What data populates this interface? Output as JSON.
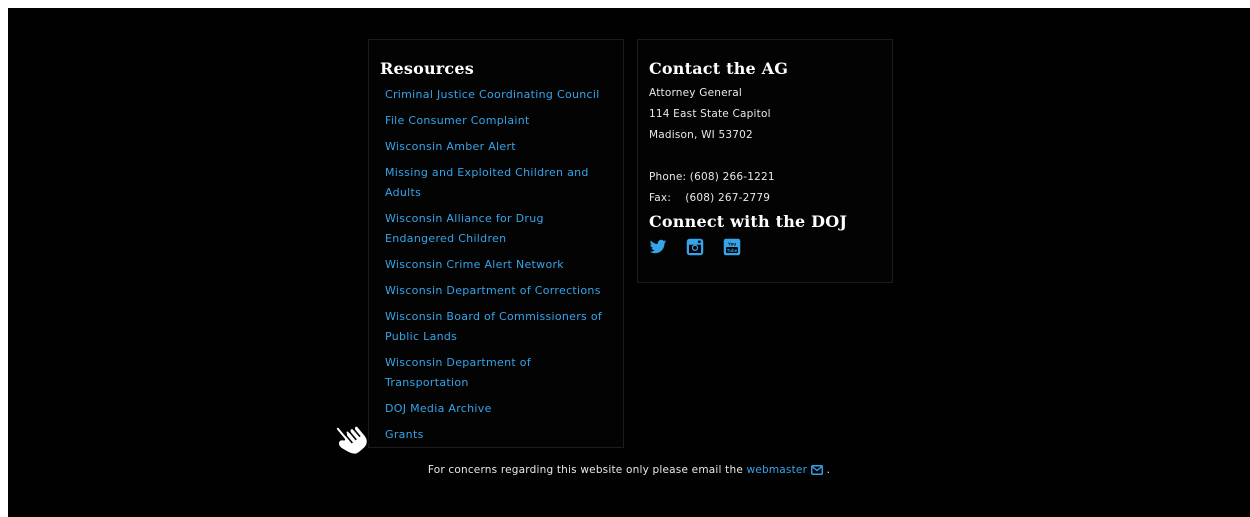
{
  "resources": {
    "title": "Resources",
    "links": [
      "Criminal Justice Coordinating Council",
      "File Consumer Complaint",
      "Wisconsin Amber Alert",
      "Missing and Exploited Children and Adults",
      "Wisconsin Alliance for Drug Endangered Children",
      "Wisconsin Crime Alert Network",
      "Wisconsin Department of Corrections",
      "Wisconsin Board of Commissioners of Public Lands",
      "Wisconsin Department of Transportation",
      "DOJ Media Archive",
      "Grants"
    ]
  },
  "contact": {
    "title": "Contact the AG",
    "name": "Attorney General",
    "address_line1": "114 East State Capitol",
    "address_line2": "Madison, WI 53702",
    "phone": "Phone: (608) 266-1221",
    "fax": "Fax:    (608) 267-2779"
  },
  "connect": {
    "title": "Connect with the DOJ",
    "icons": [
      "twitter-icon",
      "instagram-icon",
      "youtube-icon"
    ]
  },
  "footer_note": {
    "text_before": "For concerns regarding this website only please email the ",
    "link": "webmaster",
    "text_after": " ."
  },
  "colors": {
    "background": "#010101",
    "link": "#35a4ea",
    "text": "#e8e8e8",
    "heading": "#ffffff"
  }
}
